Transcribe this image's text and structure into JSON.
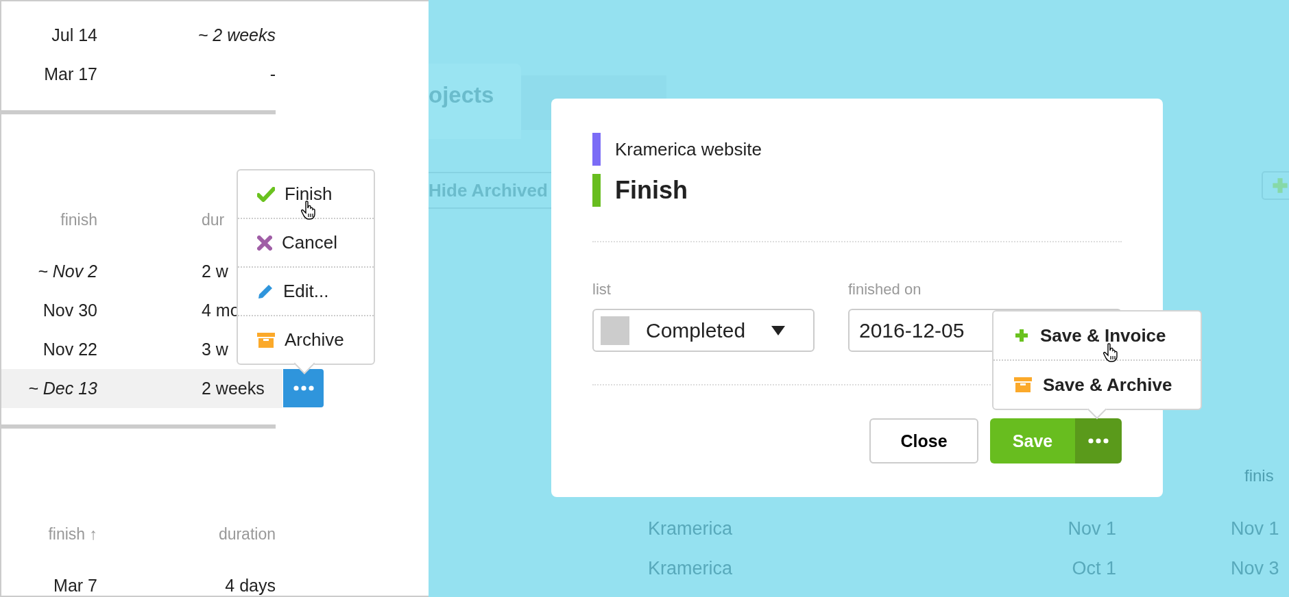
{
  "left_panel": {
    "sections": [
      {
        "rows": [
          {
            "finish": {
              "text": "Jul 14",
              "estimated": false
            },
            "duration": {
              "text": "~ 2 weeks",
              "estimated": true
            },
            "selected": false
          },
          {
            "finish": {
              "text": "Mar 17",
              "estimated": false
            },
            "duration": {
              "text": "-",
              "estimated": false
            },
            "selected": false
          }
        ]
      },
      {
        "header": {
          "finish": "finish",
          "duration": "dur"
        },
        "partial": true,
        "rows": [
          {
            "finish": {
              "text": "~ Nov 2",
              "estimated": true
            },
            "duration": {
              "text": "2 w",
              "estimated": false
            },
            "selected": false
          },
          {
            "finish": {
              "text": "Nov 30",
              "estimated": false
            },
            "duration": {
              "text": "4 mo",
              "estimated": false
            },
            "selected": false
          },
          {
            "finish": {
              "text": "Nov 22",
              "estimated": false
            },
            "duration": {
              "text": "3 w",
              "estimated": false
            },
            "selected": false
          },
          {
            "finish": {
              "text": "~ Dec 13",
              "estimated": true
            },
            "duration": {
              "text": "2 weeks",
              "estimated": false
            },
            "selected": true
          }
        ],
        "menu": [
          {
            "label": "Finish",
            "kind": "check",
            "hovered": true
          },
          {
            "label": "Cancel",
            "kind": "cross",
            "hovered": false
          },
          {
            "label": "Edit...",
            "kind": "pencil",
            "hovered": false
          },
          {
            "label": "Archive",
            "kind": "archive",
            "hovered": false
          }
        ]
      },
      {
        "header": {
          "finish": "finish ↑",
          "duration": "duration"
        },
        "rows": [
          {
            "finish": {
              "text": "Mar 7",
              "estimated": false
            },
            "duration": {
              "text": "4 days",
              "estimated": false
            },
            "selected": false
          }
        ]
      }
    ]
  },
  "background": {
    "tabs": [
      {
        "label": "ojects",
        "selected": true
      }
    ],
    "filter_button": "Hide Archived",
    "column_4_header": "finis",
    "rows": [
      {
        "client": "Kramerica",
        "column_3": "Nov 1",
        "column_4": "Nov 1"
      },
      {
        "client": "Kramerica",
        "column_3": "Oct 1",
        "column_4": "Nov 3"
      }
    ]
  },
  "dialog": {
    "project": {
      "name": "Kramerica website",
      "color": "#7b6cf6"
    },
    "task": {
      "name": "Finish",
      "color": "#68bd1f"
    },
    "fields": [
      {
        "label": "list",
        "kind": "select",
        "value": "Completed",
        "color": "#cccccc"
      },
      {
        "label": "finished on",
        "kind": "date",
        "value": "2016-12-05"
      }
    ],
    "buttons": [
      {
        "label": "Close",
        "kind": "secondary"
      },
      {
        "label": "Save",
        "kind": "primary"
      }
    ],
    "save_menu": [
      {
        "label": "Save & Invoice",
        "kind": "plus",
        "hovered": true
      },
      {
        "label": "Save & Archive",
        "kind": "archive",
        "hovered": false
      }
    ]
  }
}
